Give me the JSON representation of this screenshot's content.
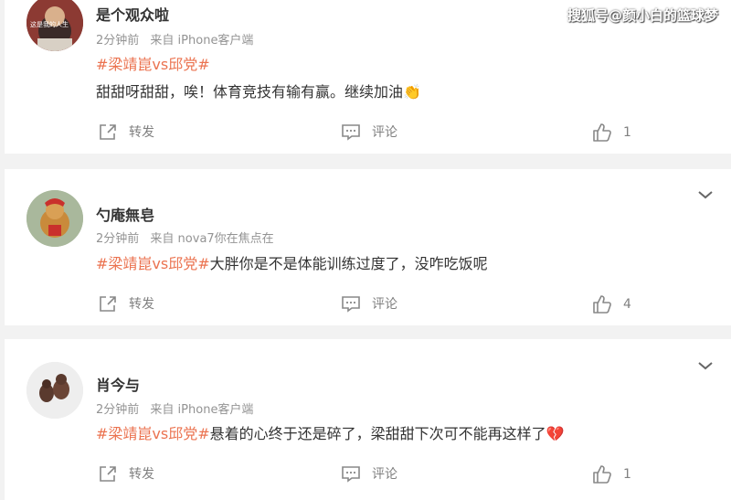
{
  "watermark": "搜狐号@颜小白的篮球梦",
  "comments": [
    {
      "username": "是个观众啦",
      "time": "2分钟前",
      "source": "来自 iPhone客户端",
      "hashtag": "#梁靖崑vs邱党#",
      "text": "甜甜呀甜甜，唉！体育竞技有输有赢。继续加油👏",
      "repost_label": "转发",
      "comment_label": "评论",
      "like_count": "1",
      "avatar_text": "这是我的人生"
    },
    {
      "username": "勺庵無皂",
      "time": "2分钟前",
      "source": "来自 nova7你在焦点在",
      "hashtag": "#梁靖崑vs邱党#",
      "text": "大胖你是不是体能训练过度了，没咋吃饭呢",
      "repost_label": "转发",
      "comment_label": "评论",
      "like_count": "4"
    },
    {
      "username": "肖今与",
      "time": "2分钟前",
      "source": "来自 iPhone客户端",
      "hashtag": "#梁靖崑vs邱党#",
      "text": "悬着的心终于还是碎了，梁甜甜下次可不能再这样了💔",
      "repost_label": "转发",
      "comment_label": "评论",
      "like_count": "1"
    }
  ]
}
